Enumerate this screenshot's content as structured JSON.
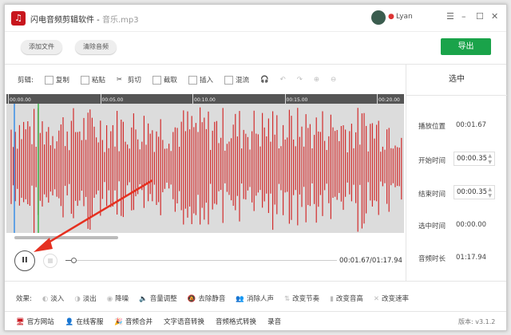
{
  "app": {
    "title": "闪电音频剪辑软件 - ",
    "file": "音乐.mp3",
    "user": "Lyan"
  },
  "toolbar": {
    "add_file": "添加文件",
    "clear_audio": "清除音频",
    "export": "导出"
  },
  "edit": {
    "label": "剪辑:",
    "items": [
      "复制",
      "粘贴",
      "剪切",
      "截取",
      "插入",
      "混流"
    ]
  },
  "timeline": {
    "ticks": [
      "00:00.00",
      "00:05.00",
      "00:10.00",
      "00:15.00",
      "00:20.00"
    ]
  },
  "player": {
    "time": "00:01.67/01:17.94",
    "progress": 0.021
  },
  "side": {
    "title": "选中",
    "play_pos_label": "播放位置",
    "play_pos": "00:01.67",
    "start_label": "开始时间",
    "start": "00:00.35",
    "end_label": "结束时间",
    "end": "00:00.35",
    "sel_label": "选中时间",
    "sel": "00:00.00",
    "dur_label": "音频时长",
    "dur": "01:17.94"
  },
  "effects": {
    "label": "效果:",
    "items": [
      "淡入",
      "淡出",
      "降噪",
      "音量调整",
      "去除静音",
      "消除人声",
      "改变节奏",
      "改变音高",
      "改变速率"
    ]
  },
  "bottom": {
    "items": [
      "官方网站",
      "在线客服",
      "音频合并",
      "文字语音转换",
      "音频格式转换",
      "录音"
    ],
    "version": "版本: v3.1.2"
  },
  "colors": {
    "accent": "#1aa34a",
    "wave": "#d22b2b",
    "brand": "#c8161d"
  }
}
